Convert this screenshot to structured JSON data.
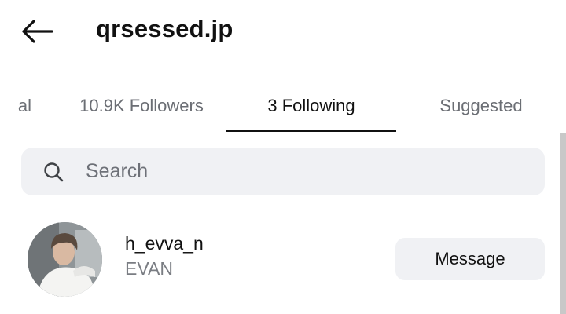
{
  "header": {
    "title": "qrsessed.jp",
    "back_icon": "arrow-left-icon"
  },
  "tabs": [
    {
      "label": "al",
      "active": false
    },
    {
      "label": "10.9K Followers",
      "active": false
    },
    {
      "label": "3 Following",
      "active": true
    },
    {
      "label": "Suggested",
      "active": false
    }
  ],
  "search": {
    "placeholder": "Search",
    "value": "",
    "icon": "search-icon"
  },
  "following": [
    {
      "username": "h_evva_n",
      "display_name": "EVAN",
      "action_label": "Message"
    }
  ],
  "colors": {
    "text": "#111111",
    "muted": "#6b6e74",
    "field_bg": "#f0f1f4",
    "active_indicator": "#111111"
  }
}
